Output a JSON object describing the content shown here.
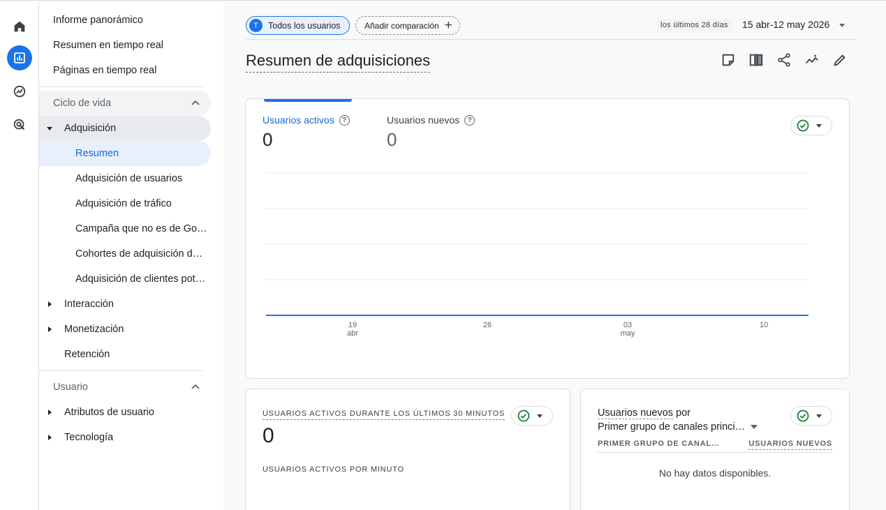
{
  "rail": {
    "items": [
      {
        "name": "home"
      },
      {
        "name": "reports",
        "active": true
      },
      {
        "name": "explore"
      },
      {
        "name": "advertising"
      }
    ]
  },
  "nav": {
    "top_items": [
      "Informe panorámico",
      "Resumen en tiempo real",
      "Páginas en tiempo real"
    ],
    "lifecycle": {
      "label": "Ciclo de vida",
      "acquisition": {
        "label": "Adquisición",
        "children": [
          "Resumen",
          "Adquisición de usuarios",
          "Adquisición de tráfico",
          "Campaña que no es de Go…",
          "Cohortes de adquisición d…",
          "Adquisición de clientes pot…"
        ]
      },
      "engagement": "Interacción",
      "monetization": "Monetización",
      "retention": "Retención"
    },
    "user": {
      "label": "Usuario",
      "attributes": "Atributos de usuario",
      "technology": "Tecnología"
    }
  },
  "header": {
    "segment_chip": "Todos los usuarios",
    "segment_initial": "T",
    "compare_chip": "Añadir comparación",
    "date_badge": "los últimos 28 días",
    "date_range": "15 abr-12 may 2026",
    "title": "Resumen de adquisiciones"
  },
  "overview_card": {
    "metric1_label": "Usuarios activos",
    "metric1_value": "0",
    "metric2_label": "Usuarios nuevos",
    "metric2_value": "0",
    "help_glyph": "?",
    "x_ticks": [
      {
        "day": "19",
        "month": "abr"
      },
      {
        "day": "26",
        "month": ""
      },
      {
        "day": "03",
        "month": "may"
      },
      {
        "day": "10",
        "month": ""
      }
    ]
  },
  "realtime_card": {
    "title": "USUARIOS ACTIVOS DURANTE LOS ÚLTIMOS 30 MINUTOS",
    "value": "0",
    "subtitle": "USUARIOS ACTIVOS POR MINUTO"
  },
  "channel_card": {
    "title_link": "Usuarios nuevos",
    "title_rest": "por",
    "dimension": "Primer grupo de canales princi…",
    "col1": "PRIMER GRUPO DE CANAL…",
    "col2": "USUARIOS NUEVOS",
    "empty": "No hay datos disponibles."
  },
  "colors": {
    "accent": "#1a73e8",
    "check_green": "#188038"
  }
}
